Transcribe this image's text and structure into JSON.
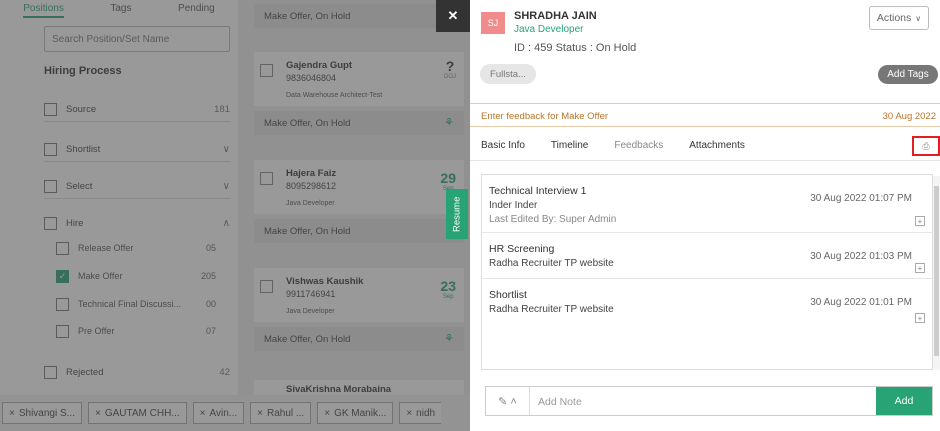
{
  "sidebar": {
    "tabs": [
      "Positions",
      "Tags",
      "Pending"
    ],
    "search_placeholder": "Search Position/Set Name",
    "section_title": "Hiring Process",
    "items": [
      {
        "label": "Source",
        "count": "181"
      },
      {
        "label": "Shortlist"
      },
      {
        "label": "Select"
      },
      {
        "label": "Hire"
      },
      {
        "label": "Rejected",
        "count": "42"
      }
    ],
    "hire_subitems": [
      {
        "label": "Release Offer",
        "count": "05"
      },
      {
        "label": "Make Offer",
        "count": "205"
      },
      {
        "label": "Technical Final Discussi...",
        "count": "00"
      },
      {
        "label": "Pre Offer",
        "count": "07"
      }
    ]
  },
  "candidates": {
    "top_status": "Make Offer, On Hold",
    "cards": [
      {
        "name": "Gajendra Gupt",
        "phone": "9836046804",
        "role": "Data Warehouse Architect-Test",
        "date": "?",
        "date_sub": "DOJ",
        "status": "Make Offer, On Hold"
      },
      {
        "name": "Hajera Faiz",
        "phone": "8095298612",
        "role": "Java Developer",
        "date": "29",
        "date_sub": "Sep",
        "status": "Make Offer, On Hold"
      },
      {
        "name": "Vishwas Kaushik",
        "phone": "9911746941",
        "role": "Java Developer",
        "date": "23",
        "date_sub": "Sep",
        "status": "Make Offer, On Hold"
      },
      {
        "name": "SivaKrishna Morabaina"
      }
    ],
    "resume_tab": "Resume"
  },
  "tagbar": {
    "chips": [
      "Shivangi S...",
      "GAUTAM CHH...",
      "Avin...",
      "Rahul ...",
      "GK Manik...",
      "nidh"
    ]
  },
  "panel": {
    "avatar_initials": "SJ",
    "name": "SHRADHA JAIN",
    "role": "Java Developer",
    "id_status": "ID : 459   Status : On Hold",
    "actions_label": "Actions",
    "tag_pill": "Fullsta...",
    "add_tags_label": "Add Tags",
    "feedback_prompt": "Enter feedback for Make Offer",
    "feedback_date": "30 Aug 2022",
    "tabs": [
      "Basic Info",
      "Timeline",
      "Feedbacks",
      "Attachments"
    ],
    "feedbacks": [
      {
        "title": "Technical Interview 1",
        "by": "Inder Inder",
        "edited": "Last Edited By: Super Admin",
        "date": "30 Aug 2022 01:07 PM"
      },
      {
        "title": "HR Screening",
        "by": "Radha Recruiter TP website",
        "date": "30 Aug 2022 01:03 PM"
      },
      {
        "title": "Shortlist",
        "by": "Radha Recruiter TP website",
        "date": "30 Aug 2022 01:01 PM"
      }
    ],
    "note_placeholder": "Add Note",
    "add_label": "Add"
  },
  "colors": {
    "accent": "#27a376",
    "highlight": "#e02020"
  }
}
